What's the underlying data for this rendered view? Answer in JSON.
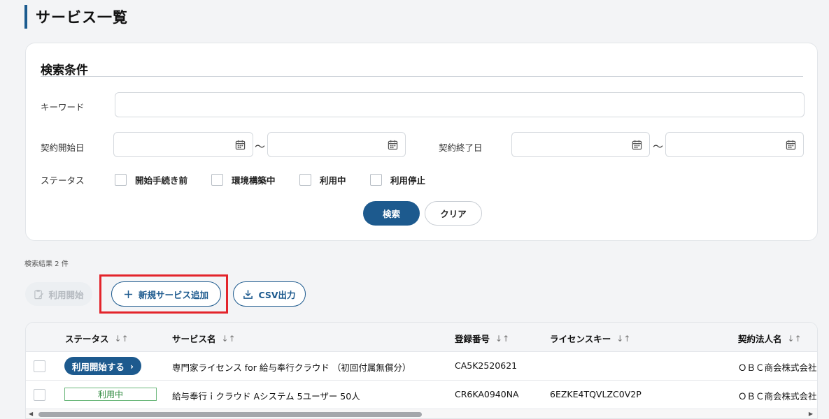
{
  "page": {
    "title": "サービス一覧"
  },
  "search": {
    "heading": "検索条件",
    "keyword_label": "キーワード",
    "keyword_value": "",
    "start_date_label": "契約開始日",
    "end_date_label": "契約終了日",
    "tilde": "〜",
    "status_label": "ステータス",
    "status_options": [
      {
        "label": "開始手続き前",
        "checked": false
      },
      {
        "label": "環境構築中",
        "checked": false
      },
      {
        "label": "利用中",
        "checked": false
      },
      {
        "label": "利用停止",
        "checked": false
      }
    ],
    "search_button": "検索",
    "clear_button": "クリア"
  },
  "results": {
    "count_text": "検索結果 2 件"
  },
  "actions": {
    "start_use": "利用開始",
    "new_service": "新規サービス追加",
    "csv_export": "CSV出力"
  },
  "table": {
    "headers": [
      "ステータス",
      "サービス名",
      "登録番号",
      "ライセンスキー",
      "契約法人名"
    ],
    "sort_glyph": "↓↑",
    "rows": [
      {
        "status": "利用開始する",
        "service_name": "専門家ライセンス for 給与奉行クラウド （初回付属無償分）",
        "reg_no": "CA5K2520621",
        "license_key": "",
        "company": "ＯＢＣ商会株式会社"
      },
      {
        "status": "利用中",
        "service_name": "給与奉行ｉクラウド Aシステム 5ユーザー 50人",
        "reg_no": "CR6KA0940NA",
        "license_key": "6EZKE4TQVLZC0V2P",
        "company": "ＯＢＣ商会株式会社"
      }
    ]
  },
  "colors": {
    "primary": "#1d5a8e",
    "highlight": "#e3242b",
    "active_green": "#2f8a3f"
  },
  "icons": [
    "calendar-icon",
    "plus-icon",
    "download-icon",
    "clipboard-edit-icon",
    "chevron-right-icon",
    "sort-icon"
  ]
}
